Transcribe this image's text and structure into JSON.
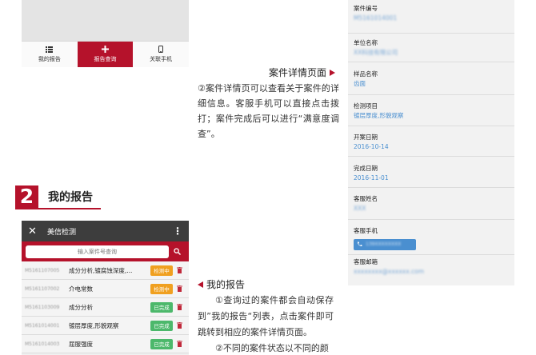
{
  "top_phone": {
    "tabs": [
      {
        "label": "我的报告",
        "icon": "list-icon",
        "active": false
      },
      {
        "label": "报告查询",
        "icon": "plus-icon",
        "active": true
      },
      {
        "label": "关联手机",
        "icon": "phone-icon",
        "active": false
      }
    ]
  },
  "detail_section": {
    "title": "案件详情页面",
    "body": "②案件详情页可以查看关于案件的详细信息。客服手机可以直接点击拨打；案件完成后可以进行“满意度调查”。"
  },
  "section2": {
    "number": "2",
    "title": "我的报告"
  },
  "phone2": {
    "app_title": "美信检测",
    "search_placeholder": "输入案件号查询",
    "rows": [
      {
        "case_no": "M5161107005",
        "name": "成分分析,镀腐蚀深度,...",
        "status": "检测中",
        "state": "testing"
      },
      {
        "case_no": "M5161107002",
        "name": "介电常数",
        "status": "检测中",
        "state": "testing"
      },
      {
        "case_no": "M5161103009",
        "name": "成分分析",
        "status": "已完成",
        "state": "done"
      },
      {
        "case_no": "M5161014001",
        "name": "镀层厚度,形貌观察",
        "status": "已完成",
        "state": "done"
      },
      {
        "case_no": "M5161014003",
        "name": "屈服强度",
        "status": "已完成",
        "state": "done"
      }
    ]
  },
  "report_section": {
    "title": "我的报告",
    "para1": "①查询过的案件都会自动保存到”我的报告“列表，点击案件即可跳转到相应的案件详情页面。",
    "para2": "②不同的案件状态以不同的颜"
  },
  "panel": {
    "fields": [
      {
        "label": "案件编号",
        "value": "M5161014001",
        "blur": true
      },
      {
        "label": "单位名称",
        "value": "XX科技有限公司",
        "blur": true
      },
      {
        "label": "样品名称",
        "value": "齿面",
        "blur": false
      },
      {
        "label": "检测项目",
        "value": "镀层厚度,形貌观察",
        "blur": false
      },
      {
        "label": "开案日期",
        "value": "2016-10-14",
        "blur": false
      },
      {
        "label": "完成日期",
        "value": "2016-11-01",
        "blur": false
      },
      {
        "label": "客服姓名",
        "value": "XXX",
        "blur": true
      },
      {
        "label": "客服手机",
        "value": "139XXXXXXXX",
        "blur": true,
        "is_phone": true
      },
      {
        "label": "客服邮箱",
        "value": "xxxxxxxx@xxxxxx.com",
        "blur": true
      }
    ]
  },
  "colors": {
    "brand": "#b5122b",
    "link": "#4a8fd0",
    "testing": "#f0a020",
    "done": "#4cb86b"
  }
}
